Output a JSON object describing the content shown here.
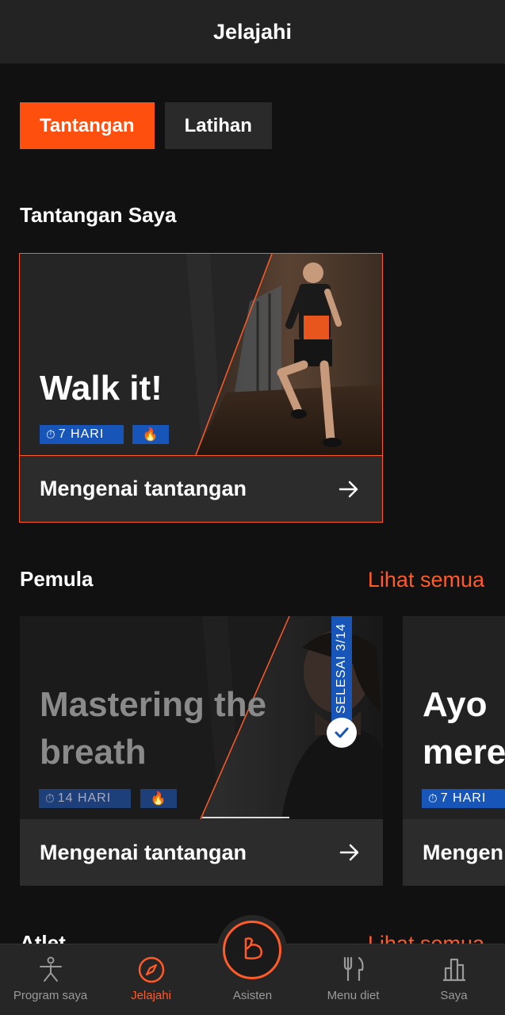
{
  "header": {
    "title": "Jelajahi"
  },
  "tabs": [
    {
      "label": "Tantangan",
      "active": true
    },
    {
      "label": "Latihan",
      "active": false
    }
  ],
  "my_challenges": {
    "title": "Tantangan Saya",
    "card": {
      "title": "Walk it!",
      "days_badge": "7 HARI",
      "footer": "Mengenai tantangan"
    }
  },
  "beginner": {
    "title": "Pemula",
    "see_all": "Lihat semua",
    "cards": [
      {
        "title_line1": "Mastering the",
        "title_line2": "breath",
        "days_badge": "14 HARI",
        "progress": "SELESAI 3/14",
        "footer": "Mengenai tantangan"
      },
      {
        "title_line1": "Ayo",
        "title_line2": "mere",
        "days_badge": "7 HARI",
        "footer": "Mengen"
      }
    ]
  },
  "athletes": {
    "title": "Atlet",
    "see_all": "Lihat semua"
  },
  "bottom_nav": [
    {
      "label": "Program saya",
      "icon": "yoga-person-icon",
      "active": false
    },
    {
      "label": "Jelajahi",
      "icon": "compass-icon",
      "active": true
    },
    {
      "label": "Asisten",
      "icon": "bicep-icon",
      "active": false
    },
    {
      "label": "Menu diet",
      "icon": "fork-knife-icon",
      "active": false
    },
    {
      "label": "Saya",
      "icon": "bar-chart-icon",
      "active": false
    }
  ],
  "colors": {
    "accent": "#ff5a28",
    "tab_active": "#ff4f0f",
    "badge": "#1756b8",
    "background": "#111111"
  }
}
